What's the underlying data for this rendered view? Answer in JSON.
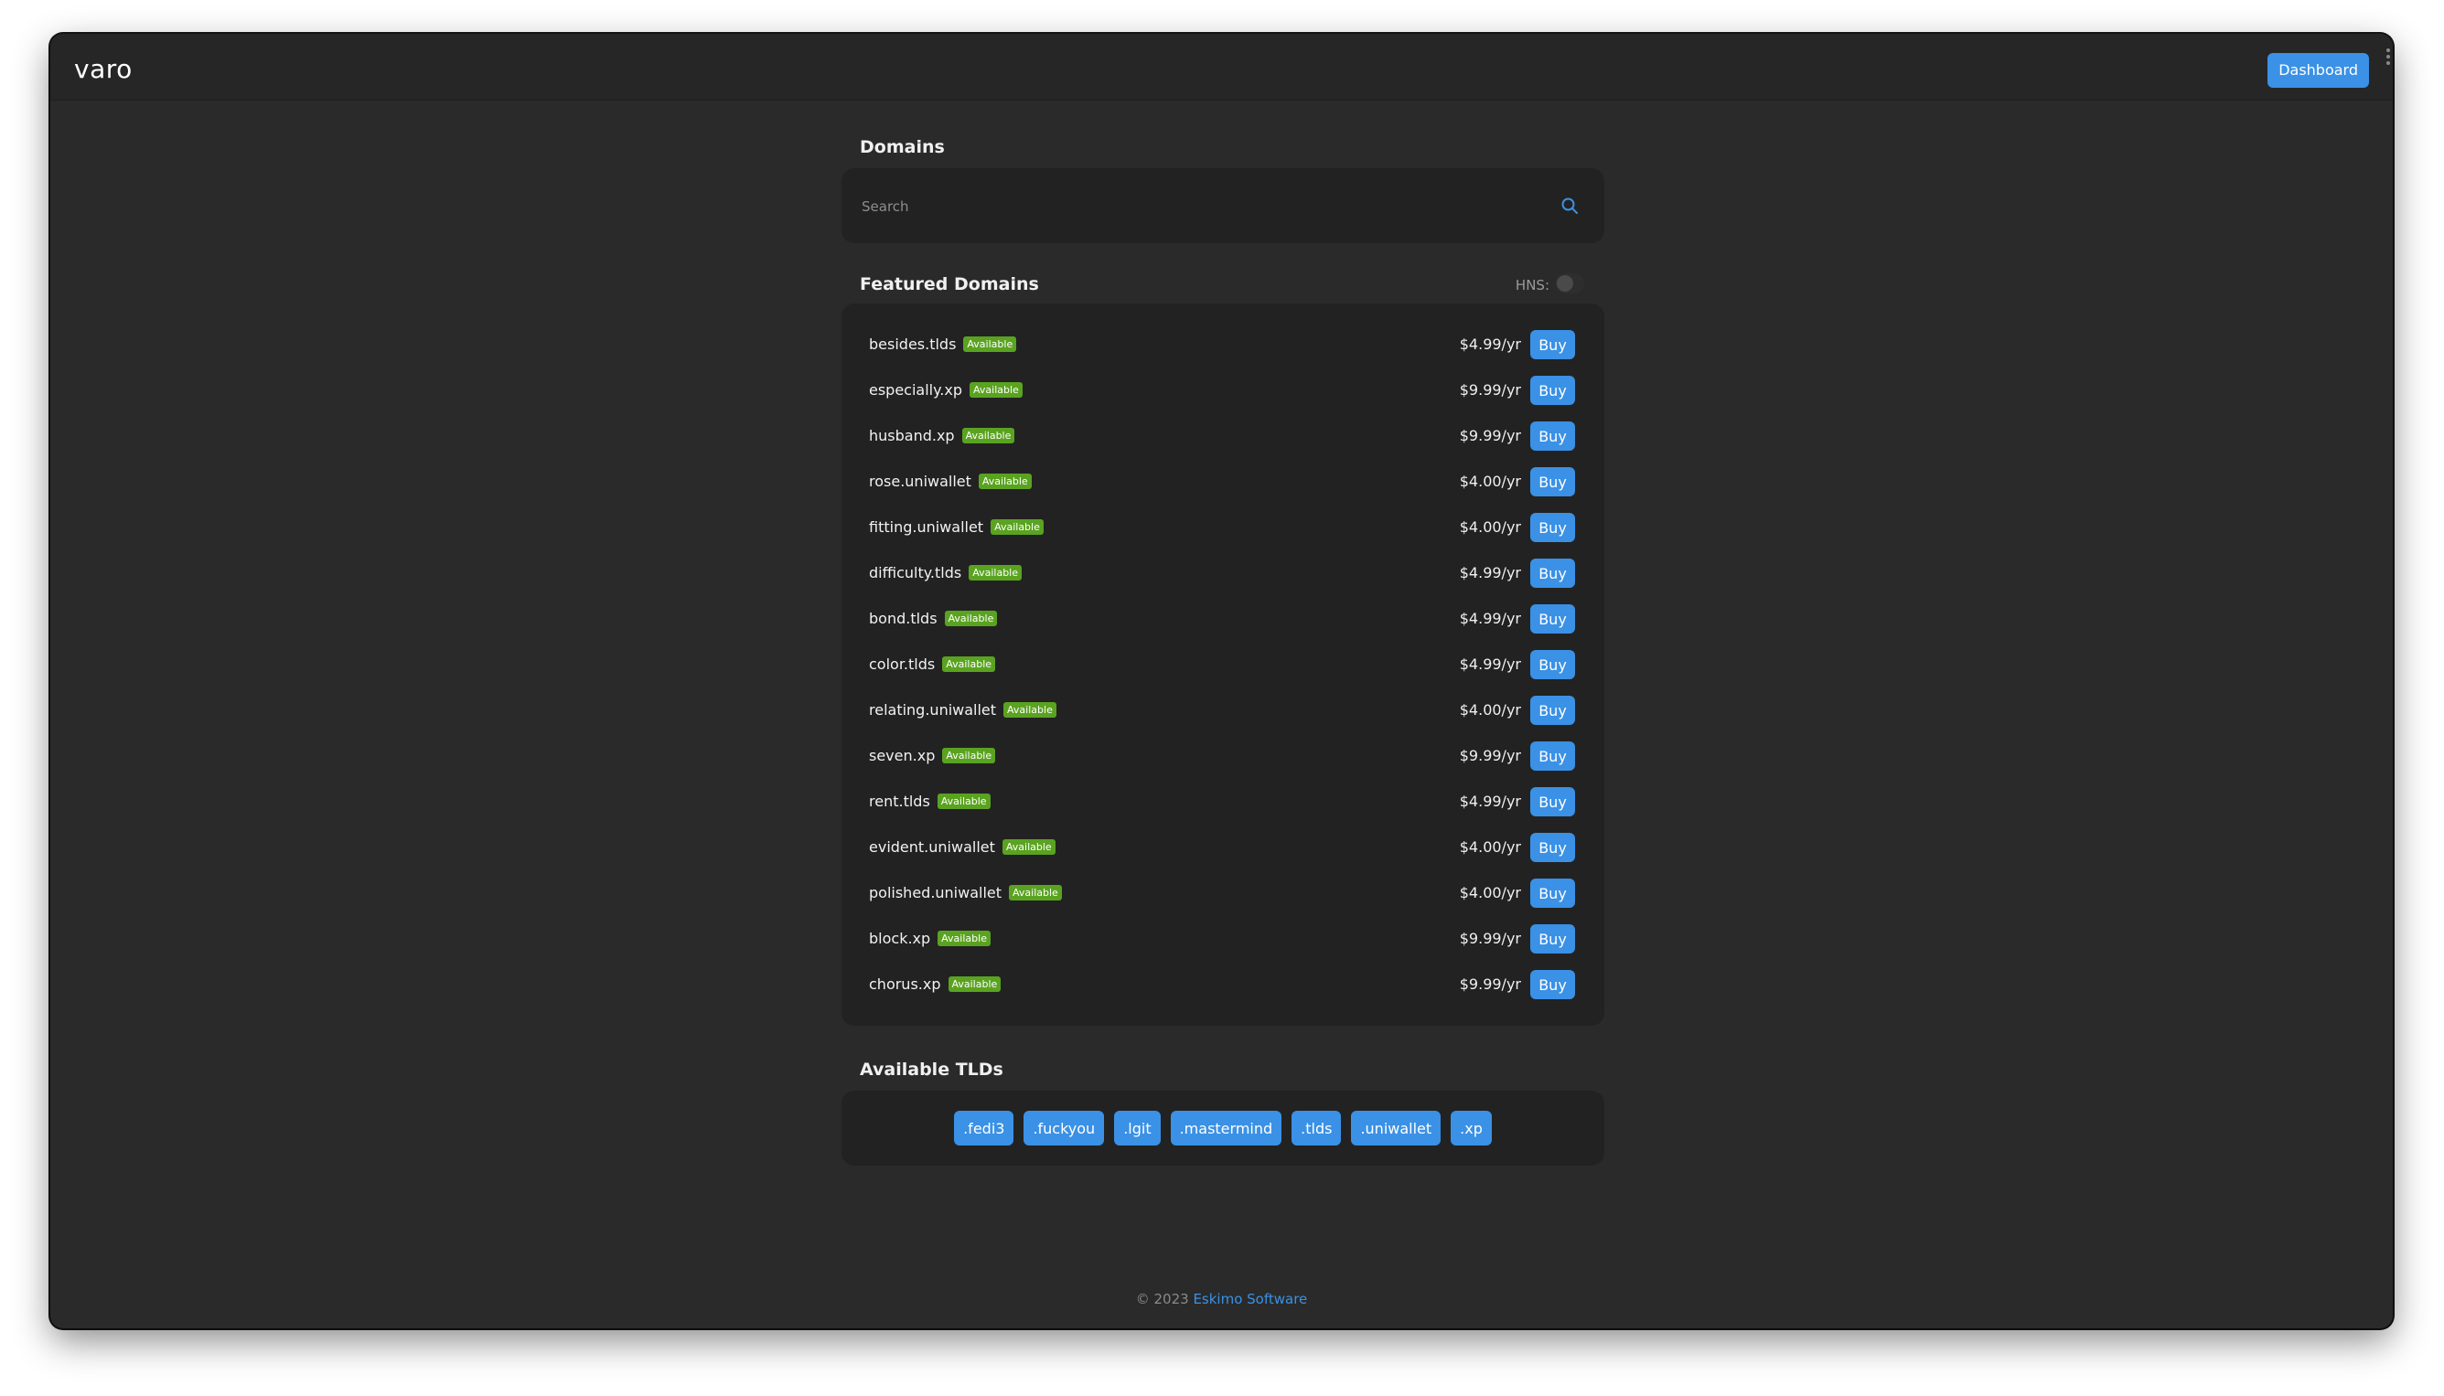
{
  "topbar": {
    "brand": "varo",
    "dashboard_label": "Dashboard"
  },
  "domains_section": {
    "title": "Domains",
    "search_placeholder": "Search"
  },
  "featured": {
    "title": "Featured Domains",
    "hns_label": "HNS:",
    "hns_enabled": false,
    "badge_label": "Available",
    "buy_label": "Buy",
    "items": [
      {
        "name": "besides.tlds",
        "price": "$4.99/yr"
      },
      {
        "name": "especially.xp",
        "price": "$9.99/yr"
      },
      {
        "name": "husband.xp",
        "price": "$9.99/yr"
      },
      {
        "name": "rose.uniwallet",
        "price": "$4.00/yr"
      },
      {
        "name": "fitting.uniwallet",
        "price": "$4.00/yr"
      },
      {
        "name": "difficulty.tlds",
        "price": "$4.99/yr"
      },
      {
        "name": "bond.tlds",
        "price": "$4.99/yr"
      },
      {
        "name": "color.tlds",
        "price": "$4.99/yr"
      },
      {
        "name": "relating.uniwallet",
        "price": "$4.00/yr"
      },
      {
        "name": "seven.xp",
        "price": "$9.99/yr"
      },
      {
        "name": "rent.tlds",
        "price": "$4.99/yr"
      },
      {
        "name": "evident.uniwallet",
        "price": "$4.00/yr"
      },
      {
        "name": "polished.uniwallet",
        "price": "$4.00/yr"
      },
      {
        "name": "block.xp",
        "price": "$9.99/yr"
      },
      {
        "name": "chorus.xp",
        "price": "$9.99/yr"
      }
    ]
  },
  "tlds": {
    "title": "Available TLDs",
    "items": [
      ".fedi3",
      ".fuckyou",
      ".lgit",
      ".mastermind",
      ".tlds",
      ".uniwallet",
      ".xp"
    ]
  },
  "footer": {
    "copyright": "© 2023",
    "company": "Eskimo Software"
  },
  "colors": {
    "accent": "#3a91e6",
    "available": "#5aa320",
    "background": "#2a2a2a",
    "card": "#222222"
  },
  "icons": {
    "search": "search-icon"
  }
}
